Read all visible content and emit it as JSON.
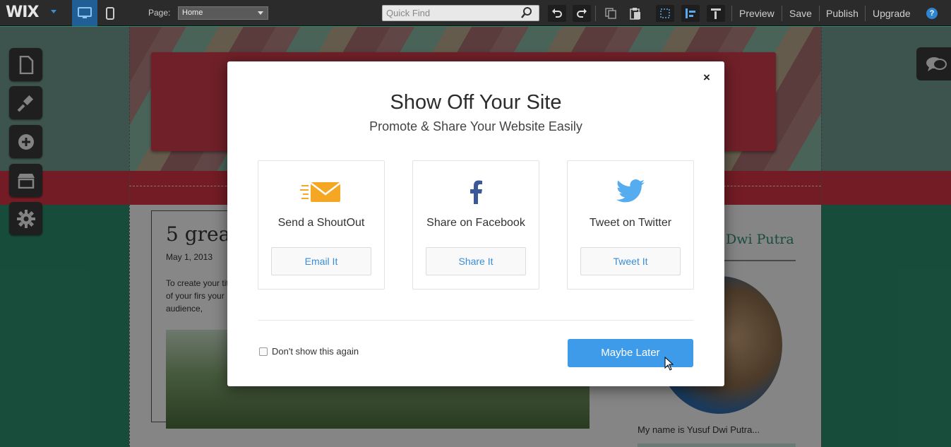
{
  "toolbar": {
    "logo": "WIX",
    "page_label": "Page:",
    "page_value": "Home",
    "quickfind_placeholder": "Quick Find",
    "links": [
      "Preview",
      "Save",
      "Publish",
      "Upgrade"
    ],
    "help": "?"
  },
  "editor": {
    "post_title": "5 great",
    "post_date": "May 1, 2013",
    "post_excerpt": "To create your title of your firs your audience,",
    "sidebar_name": "Dwi Putra",
    "sidebar_bio": "My name is Yusuf Dwi Putra..."
  },
  "modal": {
    "close": "×",
    "title": "Show Off Your Site",
    "subtitle": "Promote & Share Your Website Easily",
    "options": [
      {
        "icon": "envelope-icon",
        "label": "Send a ShoutOut",
        "button": "Email It"
      },
      {
        "icon": "facebook-icon",
        "label": "Share on Facebook",
        "button": "Share It"
      },
      {
        "icon": "twitter-icon",
        "label": "Tweet on Twitter",
        "button": "Tweet It"
      }
    ],
    "dont_show": "Don't show this again",
    "maybe_later": "Maybe Later"
  },
  "colors": {
    "accent": "#3d9be9",
    "link": "#3a8dd6",
    "toolbar_bg": "#2b2b2b",
    "facebook": "#3b5998",
    "twitter": "#55acee",
    "envelope": "#f5a623"
  }
}
